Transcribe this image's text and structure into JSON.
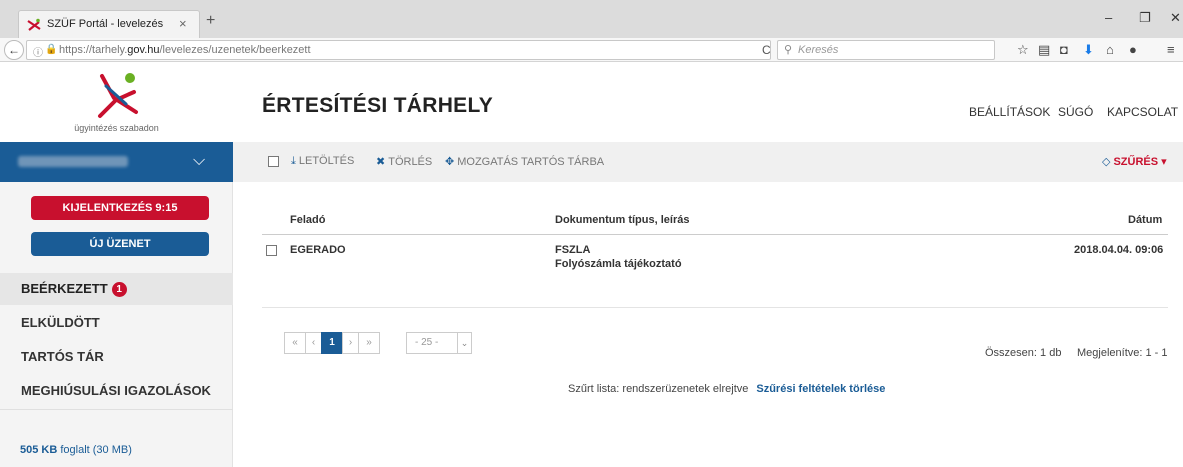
{
  "browser": {
    "tab_title": "SZÜF Portál - levelezés",
    "tab_close": "×",
    "new_tab": "+",
    "url_prefix": "https://tarhely.",
    "url_domain": "gov.hu",
    "url_suffix": "/levelezes/uzenetek/beerkezett",
    "search_placeholder": "Keresés",
    "reload": "C",
    "minimize": "–",
    "restore": "❐",
    "close": "✕"
  },
  "sidebar": {
    "logo_tagline": "ügyintézés szabadon",
    "logout_label": "KIJELENTKEZÉS 9:15",
    "new_message_label": "ÚJ ÜZENET",
    "items": [
      {
        "label": "Beérkezett",
        "badge": "1"
      },
      {
        "label": "Elküldött"
      },
      {
        "label": "Tartós tár"
      },
      {
        "label": "Meghiúsulási igazolások"
      }
    ],
    "storage_used": "505 KB",
    "storage_rest": " foglalt (30 MB)"
  },
  "header": {
    "title": "ÉRTESÍTÉSI TÁRHELY",
    "nav": [
      "BEÁLLÍTÁSOK",
      "SÚGÓ",
      "KAPCSOLAT"
    ]
  },
  "toolbar": {
    "download": "LETÖLTÉS",
    "delete": "TÖRLÉS",
    "move": "MOZGATÁS TARTÓS TÁRBA",
    "filter": "SZŰRÉS"
  },
  "table": {
    "columns": [
      "Feladó",
      "Dokumentum típus, leírás",
      "Dátum"
    ],
    "rows": [
      {
        "sender": "EGERADO",
        "doc_type": "FSZLA",
        "doc_desc": "Folyószámla tájékoztató",
        "date": "2018.04.04. 09:06"
      }
    ]
  },
  "pagination": {
    "first": "«",
    "prev": "‹",
    "current": "1",
    "next": "›",
    "last": "»",
    "page_size": "- 25 -",
    "total": "Összesen: 1 db",
    "shown": "Megjelenítve: 1 - 1"
  },
  "filter_note": {
    "text": "Szűrt lista: rendszerüzenetek elrejtve",
    "clear_link": "Szűrési feltételek törlése"
  },
  "colors": {
    "brand_blue": "#1a5c96",
    "brand_red": "#c8102e"
  }
}
